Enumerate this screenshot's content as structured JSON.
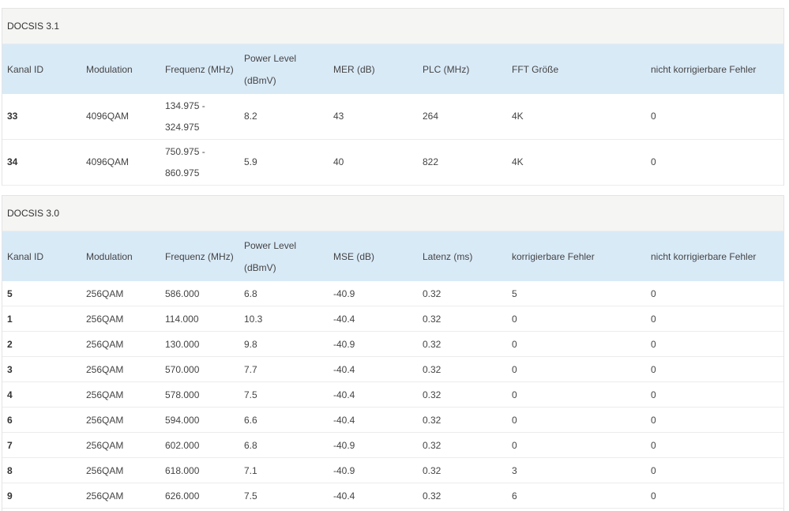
{
  "docsis31": {
    "title": "DOCSIS 3.1",
    "headers": {
      "kanal_id": "Kanal ID",
      "modulation": "Modulation",
      "frequenz": "Frequenz (MHz)",
      "power_1": "Power Level",
      "power_2": "(dBmV)",
      "mer": "MER (dB)",
      "plc": "PLC (MHz)",
      "fft": "FFT Größe",
      "nkf": "nicht korrigierbare Fehler"
    },
    "rows": [
      {
        "id": "33",
        "mod": "4096QAM",
        "freq_1": "134.975 -",
        "freq_2": "324.975",
        "power": "8.2",
        "mer": "43",
        "plc": "264",
        "fft": "4K",
        "nkf": "0"
      },
      {
        "id": "34",
        "mod": "4096QAM",
        "freq_1": "750.975 -",
        "freq_2": "860.975",
        "power": "5.9",
        "mer": "40",
        "plc": "822",
        "fft": "4K",
        "nkf": "0"
      }
    ]
  },
  "docsis30": {
    "title": "DOCSIS 3.0",
    "headers": {
      "kanal_id": "Kanal ID",
      "modulation": "Modulation",
      "frequenz": "Frequenz (MHz)",
      "power_1": "Power Level",
      "power_2": "(dBmV)",
      "mse": "MSE (dB)",
      "latenz": "Latenz (ms)",
      "kf": "korrigierbare Fehler",
      "nkf": "nicht korrigierbare Fehler"
    },
    "rows": [
      {
        "id": "5",
        "mod": "256QAM",
        "freq": "586.000",
        "power": "6.8",
        "mse": "-40.9",
        "lat": "0.32",
        "kf": "5",
        "nkf": "0"
      },
      {
        "id": "1",
        "mod": "256QAM",
        "freq": "114.000",
        "power": "10.3",
        "mse": "-40.4",
        "lat": "0.32",
        "kf": "0",
        "nkf": "0"
      },
      {
        "id": "2",
        "mod": "256QAM",
        "freq": "130.000",
        "power": "9.8",
        "mse": "-40.9",
        "lat": "0.32",
        "kf": "0",
        "nkf": "0"
      },
      {
        "id": "3",
        "mod": "256QAM",
        "freq": "570.000",
        "power": "7.7",
        "mse": "-40.4",
        "lat": "0.32",
        "kf": "0",
        "nkf": "0"
      },
      {
        "id": "4",
        "mod": "256QAM",
        "freq": "578.000",
        "power": "7.5",
        "mse": "-40.4",
        "lat": "0.32",
        "kf": "0",
        "nkf": "0"
      },
      {
        "id": "6",
        "mod": "256QAM",
        "freq": "594.000",
        "power": "6.6",
        "mse": "-40.4",
        "lat": "0.32",
        "kf": "0",
        "nkf": "0"
      },
      {
        "id": "7",
        "mod": "256QAM",
        "freq": "602.000",
        "power": "6.8",
        "mse": "-40.9",
        "lat": "0.32",
        "kf": "0",
        "nkf": "0"
      },
      {
        "id": "8",
        "mod": "256QAM",
        "freq": "618.000",
        "power": "7.1",
        "mse": "-40.9",
        "lat": "0.32",
        "kf": "3",
        "nkf": "0"
      },
      {
        "id": "9",
        "mod": "256QAM",
        "freq": "626.000",
        "power": "7.5",
        "mse": "-40.4",
        "lat": "0.32",
        "kf": "6",
        "nkf": "0"
      }
    ]
  }
}
